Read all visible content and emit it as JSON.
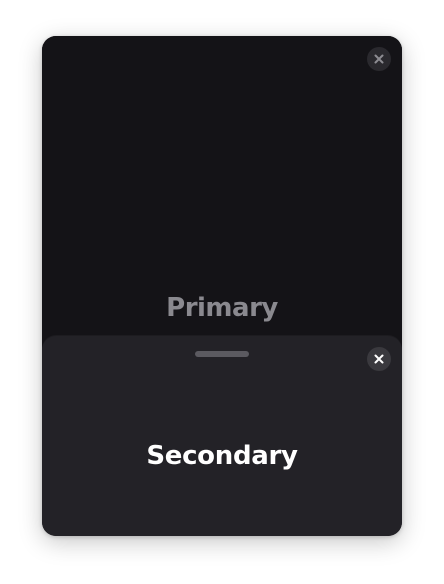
{
  "primary": {
    "title": "Primary",
    "close_icon": "close-icon"
  },
  "secondary": {
    "title": "Secondary",
    "close_icon": "close-icon",
    "grabber": "drag-handle"
  },
  "colors": {
    "page_background": "#ffffff",
    "primary_background": "#141317",
    "secondary_background": "#232227",
    "primary_text": "#8a898f",
    "secondary_text": "#ffffff"
  }
}
